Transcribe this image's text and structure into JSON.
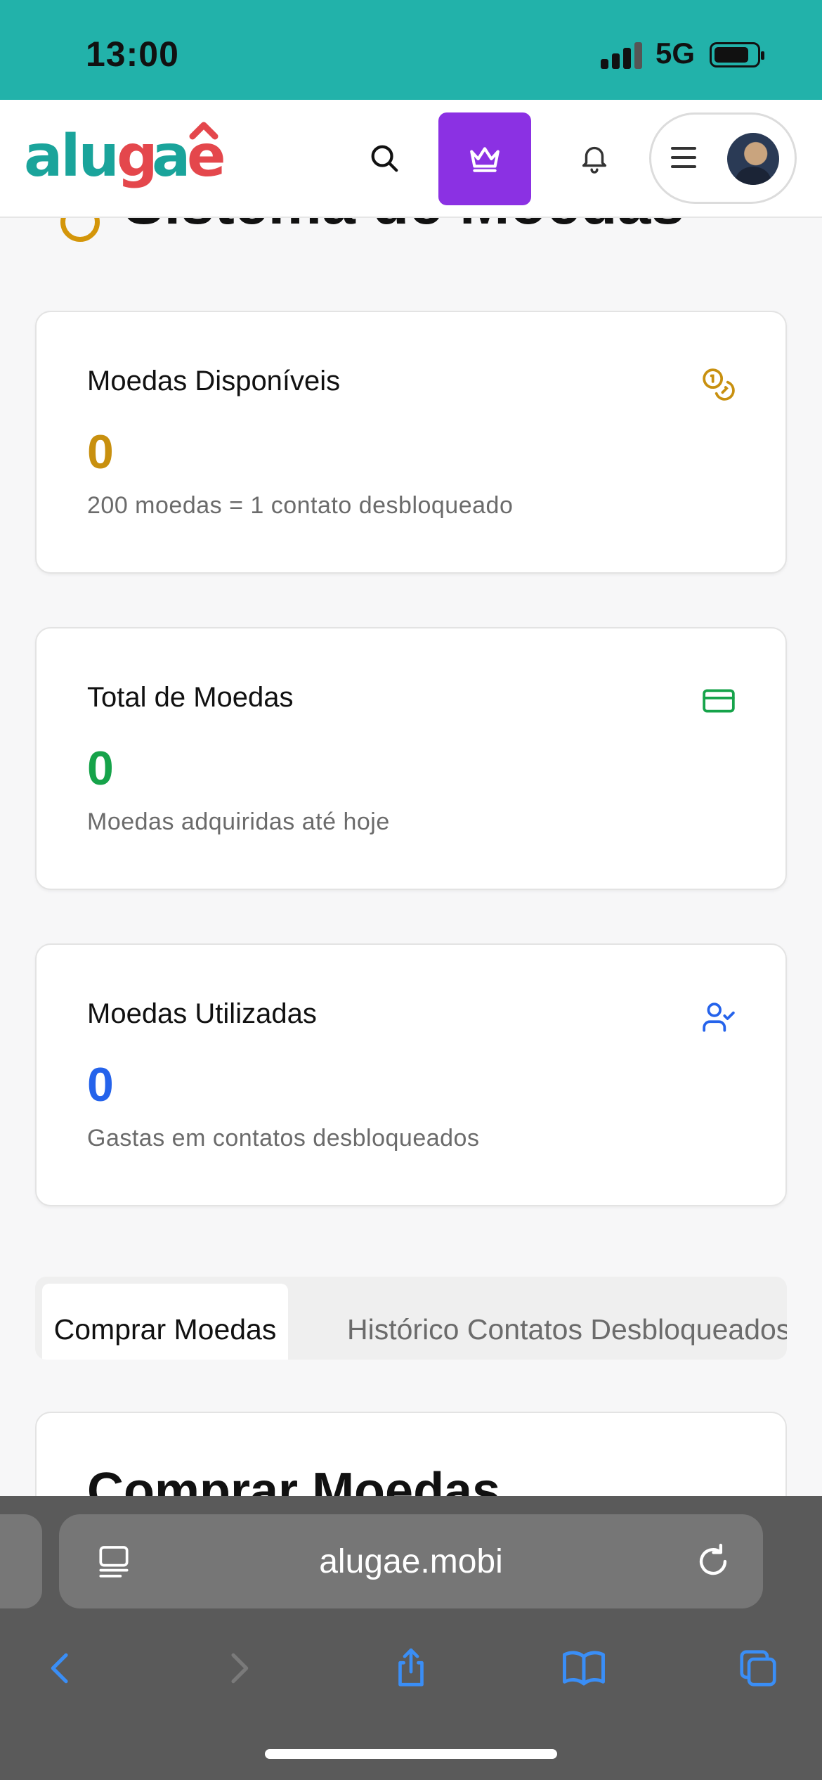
{
  "status_bar": {
    "time": "13:00",
    "network": "5G"
  },
  "header": {
    "logo_text": "alugaê",
    "icons": [
      "search-icon",
      "crown-icon",
      "bell-icon",
      "menu-icon",
      "avatar"
    ]
  },
  "page": {
    "title": "Sistema de Moedas"
  },
  "cards": [
    {
      "title": "Moedas Disponíveis",
      "value": "0",
      "subtitle": "200 moedas = 1 contato desbloqueado",
      "icon": "coins-icon",
      "color": "#c8900f"
    },
    {
      "title": "Total de Moedas",
      "value": "0",
      "subtitle": "Moedas adquiridas até hoje",
      "icon": "credit-card-icon",
      "color": "#16a34a"
    },
    {
      "title": "Moedas Utilizadas",
      "value": "0",
      "subtitle": "Gastas em contatos desbloqueados",
      "icon": "user-check-icon",
      "color": "#2563eb"
    }
  ],
  "tabs": [
    {
      "label": "Comprar Moedas",
      "active": true
    },
    {
      "label": "Histórico Contatos Desbloqueados",
      "active": false
    }
  ],
  "section": {
    "title": "Comprar Moedas"
  },
  "browser": {
    "url": "alugae.mobi"
  },
  "colors": {
    "status_bar": "#22b2aa",
    "premium_button": "#8b31e3",
    "logo_teal": "#1aa49b",
    "logo_red": "#e4474c"
  }
}
